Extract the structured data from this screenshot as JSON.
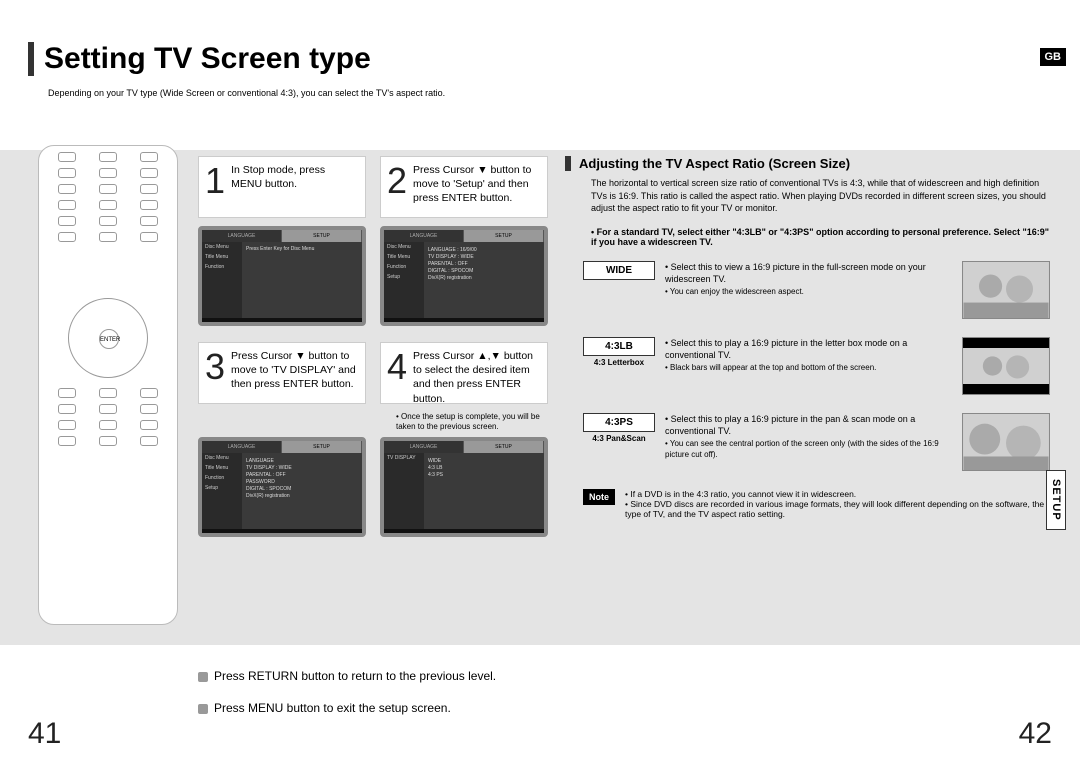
{
  "lang_badge": "GB",
  "setup_tab": "SETUP",
  "title": "Setting TV Screen type",
  "subtitle": "Depending on your TV type (Wide Screen or conventional 4:3), you can select the TV's aspect ratio.",
  "steps": [
    {
      "num": "1",
      "text": "In Stop mode, press MENU button."
    },
    {
      "num": "2",
      "text": "Press Cursor ▼ button to move to 'Setup' and then press ENTER button."
    },
    {
      "num": "3",
      "text": "Press Cursor ▼ button to move to 'TV DISPLAY' and then press ENTER button."
    },
    {
      "num": "4",
      "text": "Press Cursor ▲,▼ button to select the desired item and then press ENTER button."
    }
  ],
  "step_note": "• Once the setup is complete, you will be taken to the previous screen.",
  "osd": {
    "tabs": [
      "LANGUAGE",
      "SETUP"
    ],
    "msg1": "Press Enter Key for Disc Menu",
    "menu2": [
      [
        "LANGUAGE",
        ": 16/9/00"
      ],
      [
        "TV DISPLAY",
        ": WIDE"
      ],
      [
        "PARENTAL",
        ": OFF"
      ],
      [
        "DIGITAL",
        ": SPOCOM"
      ],
      [
        "DivX(R) registration",
        ""
      ]
    ],
    "menu3": [
      [
        "LANGUAGE",
        ""
      ],
      [
        "TV DISPLAY",
        ": WIDE"
      ],
      [
        "PARENTAL",
        ": OFF"
      ],
      [
        "PASSWORD",
        ""
      ],
      [
        "DIGITAL",
        ": SPOCOM"
      ],
      [
        "DivX(R) registration",
        ""
      ]
    ],
    "menu4_side": [
      "TV DISPLAY"
    ],
    "menu4": [
      "WIDE",
      "4:3 LB",
      "4:3 PS"
    ]
  },
  "section": {
    "heading": "Adjusting the TV Aspect Ratio (Screen Size)",
    "intro": "The horizontal to vertical screen size ratio of conventional TVs is 4:3, while that of widescreen and high definition TVs is 16:9. This ratio is called the aspect ratio. When playing DVDs recorded in different screen sizes, you should adjust the aspect ratio to fit your TV or monitor.",
    "bullet": "• For a standard TV, select either \"4:3LB\" or \"4:3PS\" option according to personal preference. Select \"16:9\" if you have a widescreen TV."
  },
  "modes": [
    {
      "label": "WIDE",
      "sublabel": "",
      "desc": "• Select this to view a 16:9 picture in the full-screen mode on your widescreen TV.",
      "sub": "• You can enjoy the widescreen aspect."
    },
    {
      "label": "4:3LB",
      "sublabel": "4:3 Letterbox",
      "desc": "• Select this to play a 16:9 picture in the letter box mode on a conventional TV.",
      "sub": "• Black bars will appear at the top and bottom of the screen."
    },
    {
      "label": "4:3PS",
      "sublabel": "4:3 Pan&Scan",
      "desc": "• Select this to play a 16:9 picture in the pan & scan mode on a conventional TV.",
      "sub": "• You can see the central portion of the screen only (with the sides of the 16:9 picture cut off)."
    }
  ],
  "note": {
    "label": "Note",
    "items": [
      "• If a DVD is in the 4:3 ratio, you cannot view it in widescreen.",
      "• Since DVD discs are recorded in various image formats, they will look different depending on the software, the type of TV, and the TV aspect ratio setting."
    ]
  },
  "footer": {
    "line1": "Press RETURN button to return to the previous level.",
    "line2": "Press MENU button to exit the setup screen.",
    "page_left": "41",
    "page_right": "42"
  }
}
